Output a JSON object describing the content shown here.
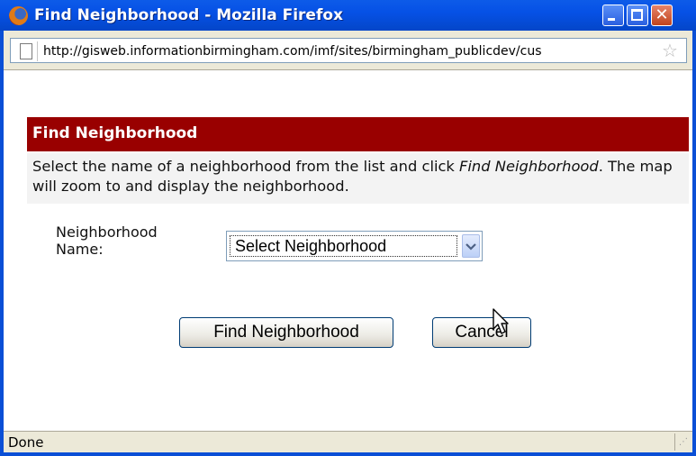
{
  "window": {
    "title": "Find Neighborhood - Mozilla Firefox",
    "minimize_label": "",
    "maximize_label": "",
    "close_label": "✕"
  },
  "urlbar": {
    "url": "http://gisweb.informationbirmingham.com/imf/sites/birmingham_publicdev/cus"
  },
  "dialog": {
    "header": "Find Neighborhood",
    "description_before": "Select the name of a neighborhood from the list and click ",
    "description_emphasis": "Find Neighborhood",
    "description_after": ". The map will zoom to and display the neighborhood.",
    "field_label": "Neighborhood Name:",
    "select_value": "Select Neighborhood",
    "find_button": "Find Neighborhood",
    "cancel_button": "Cancel"
  },
  "statusbar": {
    "text": "Done"
  },
  "colors": {
    "titlebar": "#0651e6",
    "header_bar": "#990000"
  },
  "icons": [
    "firefox-icon",
    "minimize-icon",
    "maximize-icon",
    "close-icon",
    "page-icon",
    "bookmark-star-icon",
    "chevron-down-icon",
    "mouse-cursor-icon",
    "resize-grip-icon"
  ]
}
